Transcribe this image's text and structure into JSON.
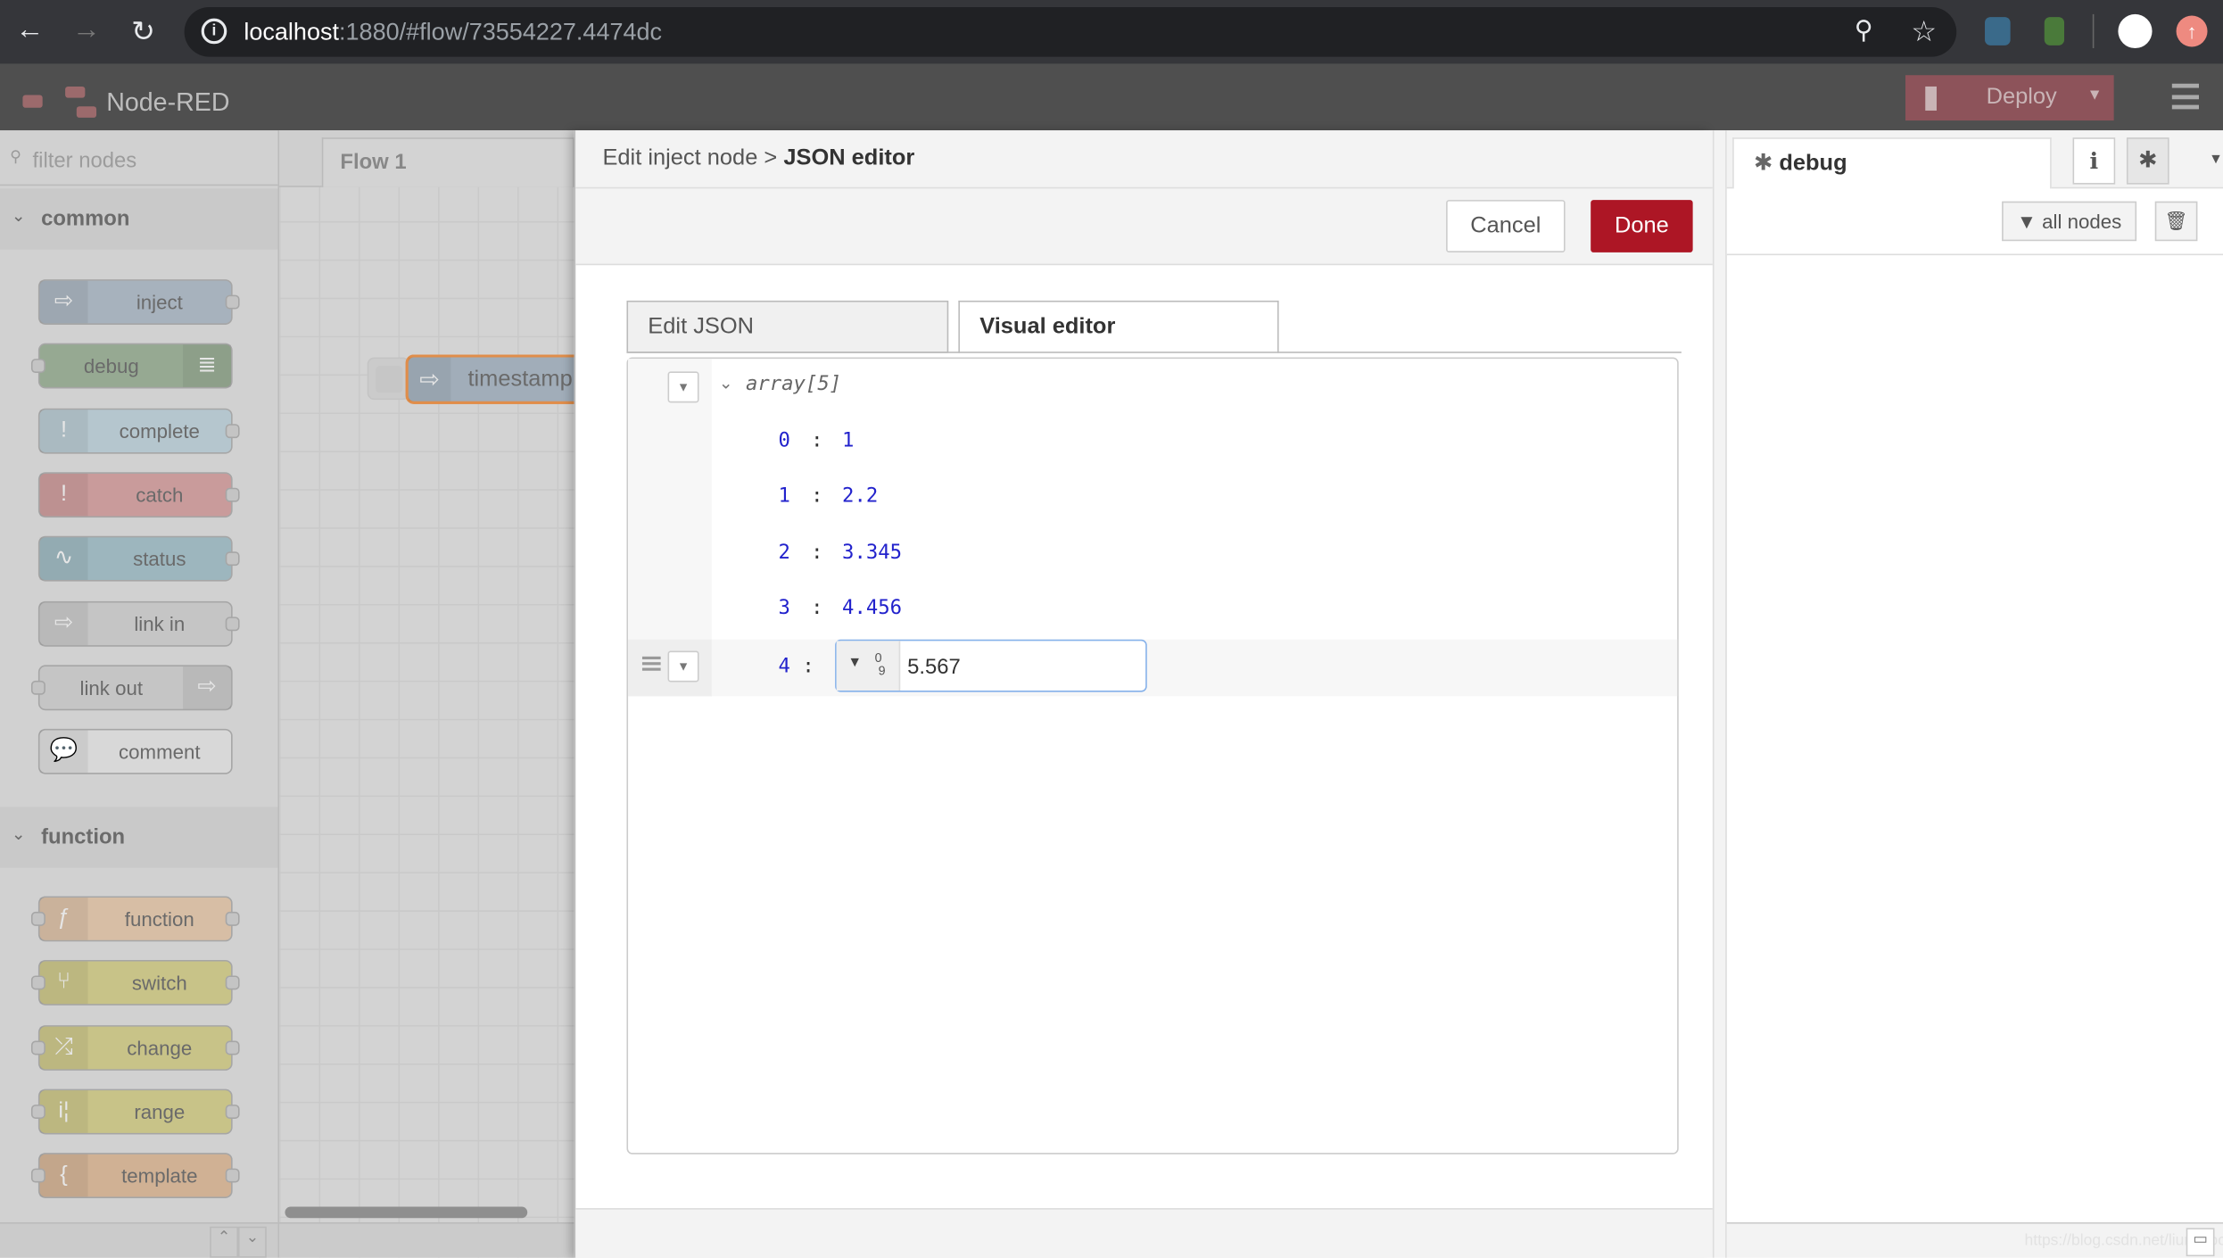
{
  "browser": {
    "url_host": "localhost",
    "url_rest": ":1880/#flow/73554227.4474dc",
    "icons": [
      "back-icon",
      "forward-icon",
      "reload-icon",
      "info-icon",
      "zoom-icon",
      "star-icon",
      "extension-icon",
      "extension-icon",
      "profile-icon",
      "update-icon"
    ]
  },
  "header": {
    "app_name": "Node-RED",
    "deploy_label": "Deploy"
  },
  "palette": {
    "filter_placeholder": "filter nodes",
    "categories": [
      {
        "name": "common",
        "nodes": [
          {
            "label": "inject",
            "color": "#a6bbcf",
            "icon": "arrow-icon"
          },
          {
            "label": "debug",
            "color": "#87a980",
            "icon": "list-icon"
          },
          {
            "label": "complete",
            "color": "#c0deed",
            "icon": "exclamation-icon"
          },
          {
            "label": "catch",
            "color": "#e49191",
            "icon": "exclamation-icon"
          },
          {
            "label": "status",
            "color": "#94c1d0",
            "icon": "pulse-icon"
          },
          {
            "label": "link in",
            "color": "#dddddd",
            "icon": "link-icon"
          },
          {
            "label": "link out",
            "color": "#dddddd",
            "icon": "link-icon"
          },
          {
            "label": "comment",
            "color": "#ffffff",
            "icon": "comment-icon"
          }
        ]
      },
      {
        "name": "function",
        "nodes": [
          {
            "label": "function",
            "color": "#fdd0a2",
            "icon": "function-icon"
          },
          {
            "label": "switch",
            "color": "#e2d96e",
            "icon": "switch-icon"
          },
          {
            "label": "change",
            "color": "#e2d96e",
            "icon": "shuffle-icon"
          },
          {
            "label": "range",
            "color": "#e2d96e",
            "icon": "range-icon"
          },
          {
            "label": "template",
            "color": "#f0b884",
            "icon": "brace-icon"
          }
        ]
      }
    ]
  },
  "workspace": {
    "tab": "Flow 1",
    "node_label": "timestamp"
  },
  "tray": {
    "breadcrumb_parent": "Edit inject node",
    "breadcrumb_sep": ">",
    "breadcrumb_current": "JSON editor",
    "cancel_label": "Cancel",
    "done_label": "Done",
    "tabs": [
      "Edit JSON",
      "Visual editor"
    ],
    "active_tab": "Visual editor",
    "root_label": "array[5]",
    "items": [
      {
        "key": "0",
        "value": "1"
      },
      {
        "key": "1",
        "value": "2.2"
      },
      {
        "key": "2",
        "value": "3.345"
      },
      {
        "key": "3",
        "value": "4.456"
      },
      {
        "key": "4",
        "value": "5.567"
      }
    ],
    "type_icon": "0-9"
  },
  "sidebar": {
    "tab": "debug",
    "filter_label": "all nodes",
    "watermark": "https://blog.csdn.net/liumiaocn"
  },
  "colors": {
    "accent": "#ad1625",
    "input_focus": "#85b1ea"
  }
}
